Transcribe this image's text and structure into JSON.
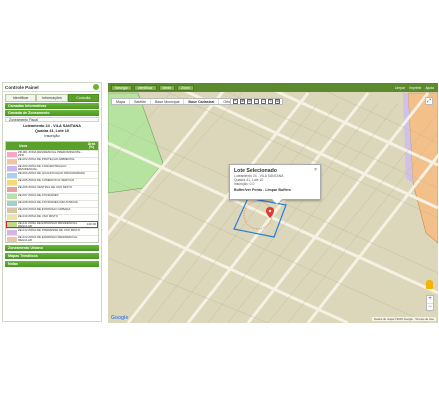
{
  "panel": {
    "title": "Controle Painel",
    "tabs": [
      {
        "label": "Identificar",
        "active": false
      },
      {
        "label": "Informações",
        "active": false
      },
      {
        "label": "Consulta",
        "active": true
      }
    ],
    "sections_top": [
      "Camadas Informativas",
      "Camada de Zoneamento"
    ],
    "subsection": "Zoneamento Fiscal",
    "lote": {
      "line1": "Loteamento 24 - VILA SANTANA",
      "line2": "Quadra 41, Lote 10",
      "line3": "Inscrição"
    },
    "table_headers": {
      "uso": "Usos",
      "area": "Área (%)"
    },
    "legend": [
      {
        "color": "#f7a8c4",
        "name": "ZR-001 ZONA RESIDENCIAL PREDOMINANTE - ZPR",
        "area": ""
      },
      {
        "color": "#f2c4a4",
        "name": "ZE-002 ZONA DE PROTEÇÃO AMBIENTAL",
        "area": ""
      },
      {
        "color": "#c9b7e8",
        "name": "ZE-003 ZONA DE CONCENTRAÇÃO RESIDENCIAL",
        "area": ""
      },
      {
        "color": "#a6d2ee",
        "name": "ZE-004 ZONA DE QUALIFICAÇÃO PROGRAMADA",
        "area": ""
      },
      {
        "color": "#f4d97a",
        "name": "ZE-005 ZONA DE COMÉRCIO E SERVIÇO",
        "area": ""
      },
      {
        "color": "#e6a0a0",
        "name": "ZE-006 ZONA CENTRAL DE USO MISTO",
        "area": ""
      },
      {
        "color": "#b8e0a8",
        "name": "ZE-007 ZONA DE ATIVIDADES",
        "area": ""
      },
      {
        "color": "#9fd3c7",
        "name": "ZE-008 ZONA DE ATIVIDADES INDUSTRIAIS",
        "area": ""
      },
      {
        "color": "#d9c6a6",
        "name": "ZE-009 ZONA DE EXPANSÃO URBANA",
        "area": ""
      },
      {
        "color": "#f0e3a0",
        "name": "ZE-010 ZONA DE USO MISTO",
        "area": ""
      },
      {
        "color": "#c2d889",
        "name": "ZE-011 ZONA DE EXPANSÃO RESIDENCIAL REGULAR",
        "area": "100,00"
      },
      {
        "color": "#d8b4e0",
        "name": "ZE-012 ZONA DE INTERESSE DE USO MISTO",
        "area": ""
      },
      {
        "color": "#e9c7a8",
        "name": "ZE-013 ZONA DE EXPANSÃO RESIDENCIAL REGULAR",
        "area": ""
      }
    ],
    "sections_bottom": [
      "Zoneamento Urbano",
      "Mapas Temáticos",
      "Notas"
    ]
  },
  "map": {
    "toolbar": [
      "Navegar",
      "Identificar",
      "Medir",
      "Zoom"
    ],
    "toolbar_right": [
      "Limpar",
      "Imprimir",
      "Ajuda"
    ],
    "tabs": [
      {
        "label": "Mapa",
        "active": false
      },
      {
        "label": "Satélite",
        "active": false
      },
      {
        "label": "Base Municipal",
        "active": false
      },
      {
        "label": "Base Cadastral",
        "active": true
      },
      {
        "label": "Ortofoto",
        "active": false
      }
    ],
    "tools": [
      "↖",
      "⊕",
      "⊖",
      "⇔",
      "□",
      "✎",
      "⊞"
    ],
    "popup": {
      "title": "Lote Selecionado",
      "close": "×",
      "lines": [
        "Loteamento 24 - VILA SANTANA",
        "Quadra 41, Lote 10",
        "Inscrição: 0-0"
      ],
      "actions": "Buffer/ver Ponto - Limpar Buffers"
    },
    "logo": "Google",
    "attribution": "Dados do mapa ©2015 Google · Termos de Uso",
    "zoom_in": "+",
    "zoom_out": "−",
    "fullscreen": "⤢"
  }
}
